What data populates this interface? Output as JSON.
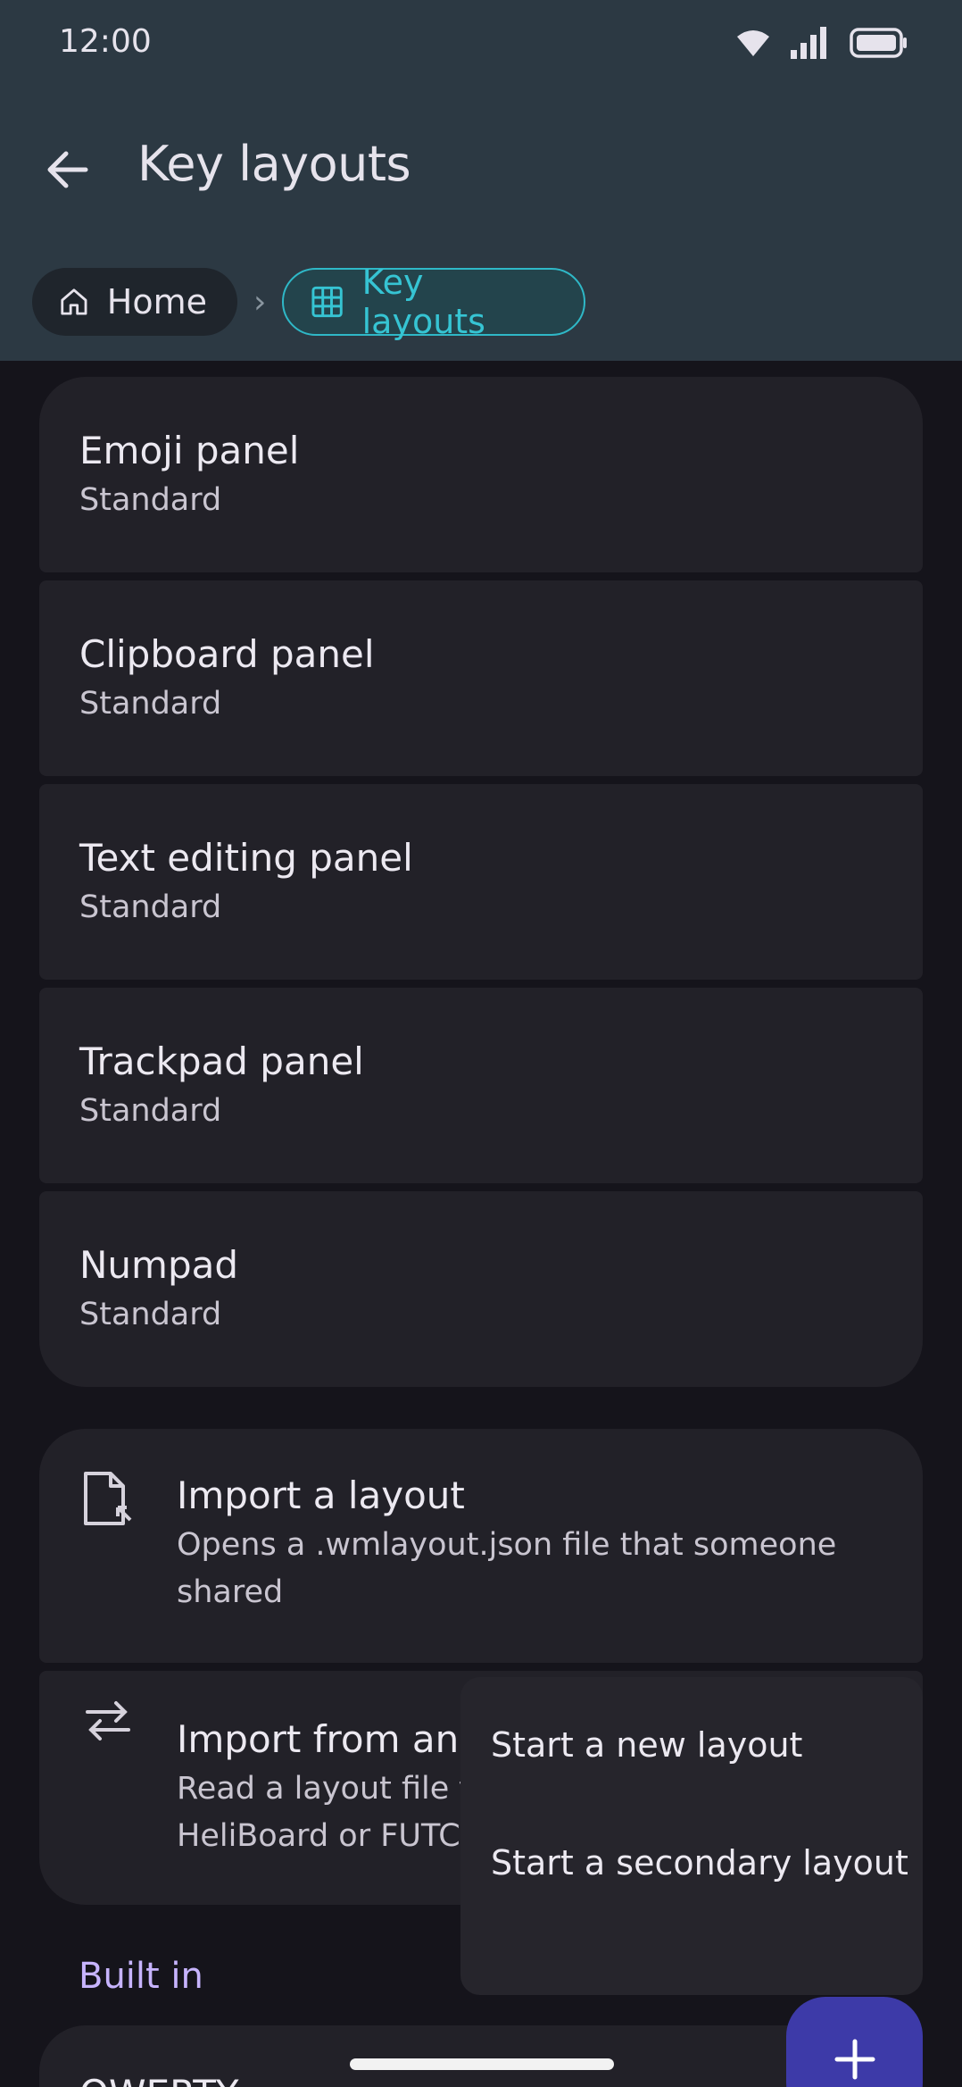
{
  "status_bar": {
    "time": "12:00"
  },
  "header": {
    "title": "Key layouts"
  },
  "breadcrumb": {
    "home": "Home",
    "current": "Key layouts"
  },
  "layouts": [
    {
      "name": "Emoji panel",
      "type": "Standard"
    },
    {
      "name": "Clipboard panel",
      "type": "Standard"
    },
    {
      "name": "Text editing panel",
      "type": "Standard"
    },
    {
      "name": "Trackpad panel",
      "type": "Standard"
    },
    {
      "name": "Numpad",
      "type": "Standard"
    }
  ],
  "import_layout": {
    "title": "Import a layout",
    "desc": "Opens a .wmlayout.json file that someone shared",
    "icon": "file-import-icon"
  },
  "import_other": {
    "title": "Import from ano",
    "desc_line1": "Read a layout file f",
    "desc_line2": "HeliBoard or FUTC",
    "icon": "swap-arrows-icon"
  },
  "section": {
    "built_in": "Built in"
  },
  "partial_card": {
    "name": "QWERTY"
  },
  "popup_menu": {
    "item1": "Start a new layout",
    "item2": "Start a secondary layout"
  },
  "colors": {
    "header_bg": "#2c3943",
    "accent": "#36c4d3",
    "section": "#c7b4ff",
    "fab": "#3d3aa8"
  }
}
